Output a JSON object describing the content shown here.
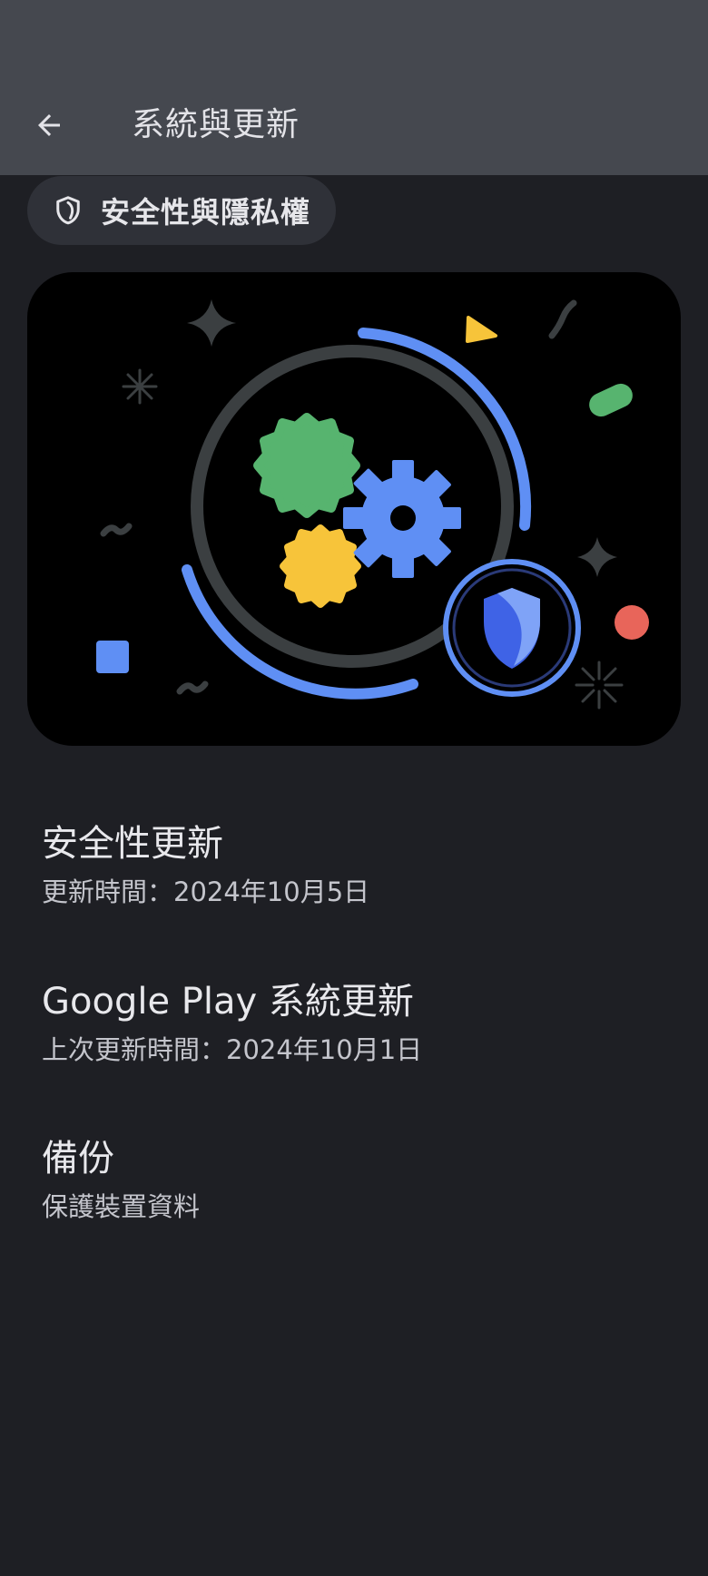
{
  "header": {
    "title": "系統與更新",
    "back_icon": "arrow-back-icon"
  },
  "chip": {
    "label": "安全性與隱私權",
    "icon": "shield-icon"
  },
  "illustration": {
    "description_icon": "security-update-illustration",
    "colors": {
      "blue": "#5f8ff4",
      "green": "#57b46f",
      "yellow": "#f7c43a",
      "red": "#e8655a",
      "gray": "#3b3f41"
    }
  },
  "settings": [
    {
      "title": "安全性更新",
      "summary": "更新時間：2024年10月5日"
    },
    {
      "title": "Google Play 系統更新",
      "summary": "上次更新時間：2024年10月1日"
    },
    {
      "title": "備份",
      "summary": "保護裝置資料"
    }
  ],
  "colors": {
    "background": "#1e1f24",
    "top_bar": "#45484f",
    "chip_background": "#2f3138",
    "text_primary": "#e8e8ec",
    "text_secondary": "#c4c5cc"
  }
}
